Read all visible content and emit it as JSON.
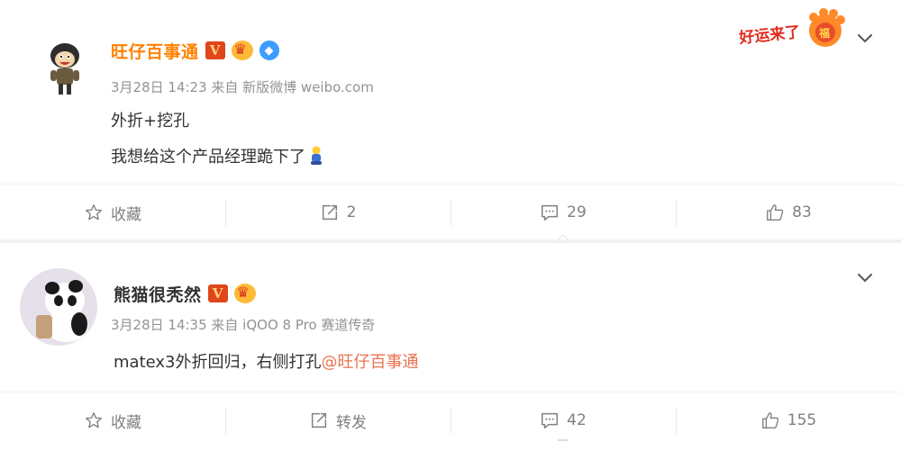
{
  "post1": {
    "username": "旺仔百事通",
    "verified_badge": "V",
    "meta": "3月28日 14:23 来自 新版微博 weibo.com",
    "lines": [
      "外折+挖孔",
      "我想给这个产品经理跪下了"
    ],
    "emoji": "kneeling-person-emoji",
    "sticker_text": "好运来了",
    "actions": {
      "favorite": "收藏",
      "repost": "2",
      "comment": "29",
      "like": "83"
    }
  },
  "post2": {
    "username": "熊猫很秃然",
    "verified_badge": "V",
    "meta": "3月28日 14:35 来自 iQOO 8 Pro 赛道传奇",
    "text": "matex3外折回归，右侧打孔",
    "mention": "@旺仔百事通",
    "actions": {
      "favorite": "收藏",
      "repost": "转发",
      "comment": "42",
      "like": "155"
    }
  },
  "colors": {
    "accent": "#ff8200",
    "link": "#eb7350",
    "muted": "#939393"
  }
}
